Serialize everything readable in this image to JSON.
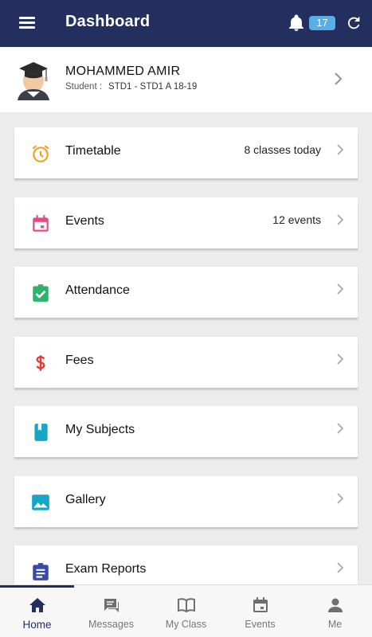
{
  "header": {
    "title": "Dashboard",
    "notification_count": "17",
    "colors": {
      "bar": "#23305f",
      "badge": "#5aaee8"
    }
  },
  "profile": {
    "name": "MOHAMMED AMIR",
    "role_label": "Student :",
    "class_info": "STD1 - STD1 A 18-19"
  },
  "menu": [
    {
      "label": "Timetable",
      "info": "8 classes today",
      "icon": "alarm-clock-icon",
      "color": "#f0a21e"
    },
    {
      "label": "Events",
      "info": "12 events",
      "icon": "calendar-icon",
      "color": "#e24b85"
    },
    {
      "label": "Attendance",
      "info": "",
      "icon": "clipboard-check-icon",
      "color": "#2fb36b"
    },
    {
      "label": "Fees",
      "info": "",
      "icon": "dollar-icon",
      "color": "#e53935"
    },
    {
      "label": "My Subjects",
      "info": "",
      "icon": "book-icon",
      "color": "#16a6c7"
    },
    {
      "label": "Gallery",
      "info": "",
      "icon": "image-icon",
      "color": "#16a6c7"
    },
    {
      "label": "Exam Reports",
      "info": "",
      "icon": "report-icon",
      "color": "#3949ab"
    }
  ],
  "bottom_nav": [
    {
      "label": "Home",
      "icon": "home-icon",
      "active": true
    },
    {
      "label": "Messages",
      "icon": "messages-icon",
      "active": false
    },
    {
      "label": "My Class",
      "icon": "open-book-icon",
      "active": false
    },
    {
      "label": "Events",
      "icon": "calendar-icon",
      "active": false
    },
    {
      "label": "Me",
      "icon": "person-icon",
      "active": false
    }
  ]
}
